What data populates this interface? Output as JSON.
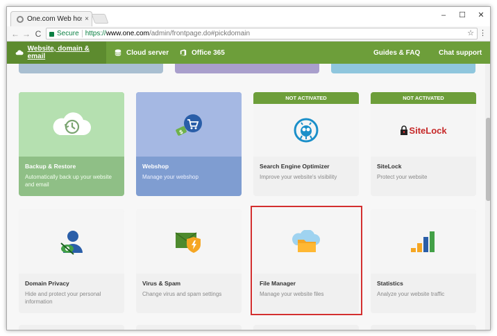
{
  "browser": {
    "tab_title": "One.com Web hosting",
    "tab_close": "×",
    "window_controls": {
      "minimize": "–",
      "maximize": "☐",
      "close": "✕"
    },
    "nav": {
      "back": "←",
      "forward": "→",
      "reload": "C"
    },
    "address": {
      "secure_label": "Secure",
      "url_scheme": "https://",
      "url_host": "www.one.com",
      "url_path": "/admin/frontpage.do#pickdomain"
    },
    "star": "☆",
    "menu": "⋮"
  },
  "site_nav": {
    "items": [
      {
        "label": "Website, domain & email",
        "icon": "cloud-icon",
        "active": true
      },
      {
        "label": "Cloud server",
        "icon": "database-icon"
      },
      {
        "label": "Office 365",
        "icon": "office-icon"
      }
    ],
    "right_items": [
      {
        "label": "Guides & FAQ"
      },
      {
        "label": "Chat support"
      }
    ]
  },
  "colors": {
    "nav_green": "#6d9e3a",
    "backup_green": "#b5e0b0",
    "webshop_blue": "#a5b8e3",
    "highlight_red": "#d32f2f"
  },
  "cards": [
    {
      "title": "Backup & Restore",
      "desc": "Automatically back up your website and email",
      "icon": "cloud-history-icon"
    },
    {
      "title": "Webshop",
      "desc": "Manage your webshop",
      "icon": "shopping-cart-icon"
    },
    {
      "title": "Search Engine Optimizer",
      "desc": "Improve your website's visibility",
      "icon": "seo-robot-icon",
      "badge": "NOT ACTIVATED"
    },
    {
      "title": "SiteLock",
      "desc": "Protect your website",
      "icon": "sitelock-logo-icon",
      "badge": "NOT ACTIVATED",
      "logo_text": "SiteLock"
    },
    {
      "title": "Domain Privacy",
      "desc": "Hide and protect your personal information",
      "icon": "privacy-user-icon"
    },
    {
      "title": "Virus & Spam",
      "desc": "Change virus and spam settings",
      "icon": "virus-shield-icon"
    },
    {
      "title": "File Manager",
      "desc": "Manage your website files",
      "icon": "folder-cloud-icon"
    },
    {
      "title": "Statistics",
      "desc": "Analyze your website traffic",
      "icon": "bar-chart-icon"
    }
  ]
}
